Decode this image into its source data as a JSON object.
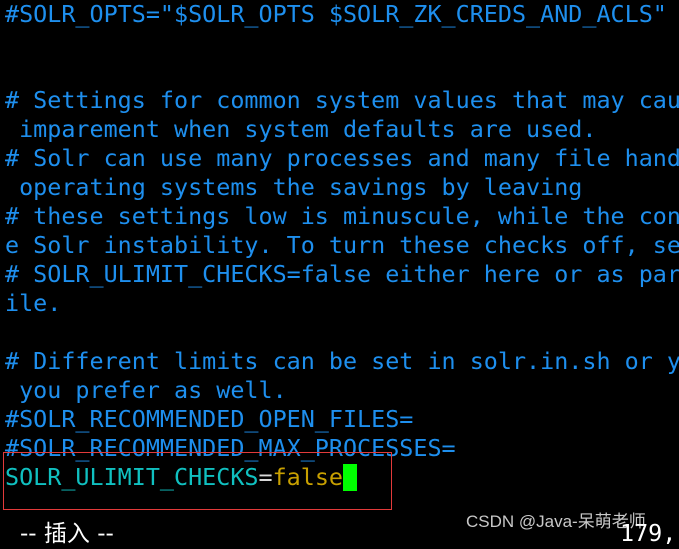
{
  "editor": {
    "lines": [
      {
        "text": "#SOLR_OPTS=\"$SOLR_OPTS $SOLR_ZK_CREDS_AND_ACLS\""
      },
      {
        "text": ""
      },
      {
        "text": ""
      },
      {
        "text": "# Settings for common system values that may cau"
      },
      {
        "text": " imparement when system defaults are used."
      },
      {
        "text": "# Solr can use many processes and many file hand"
      },
      {
        "text": " operating systems the savings by leaving"
      },
      {
        "text": "# these settings low is minuscule, while the con"
      },
      {
        "text": "e Solr instability. To turn these checks off, se"
      },
      {
        "text": "# SOLR_ULIMIT_CHECKS=false either here or as par"
      },
      {
        "text": "ile."
      },
      {
        "text": ""
      },
      {
        "text": "# Different limits can be set in solr.in.sh or y"
      },
      {
        "text": " you prefer as well."
      },
      {
        "text": "#SOLR_RECOMMENDED_OPEN_FILES="
      },
      {
        "text": "#SOLR_RECOMMENDED_MAX_PROCESSES="
      }
    ],
    "active_line": {
      "variable": "SOLR_ULIMIT_CHECKS",
      "operator": "=",
      "value": "false"
    }
  },
  "colors": {
    "comment": "#1e8fee",
    "variable": "#10c0c0",
    "value": "#c8a000",
    "cursor": "#00ff00",
    "highlight_box": "#e23a3a"
  },
  "status_bar": {
    "mode": "-- 插入 --",
    "position": "179,"
  },
  "watermark": "CSDN @Java-呆萌老师"
}
